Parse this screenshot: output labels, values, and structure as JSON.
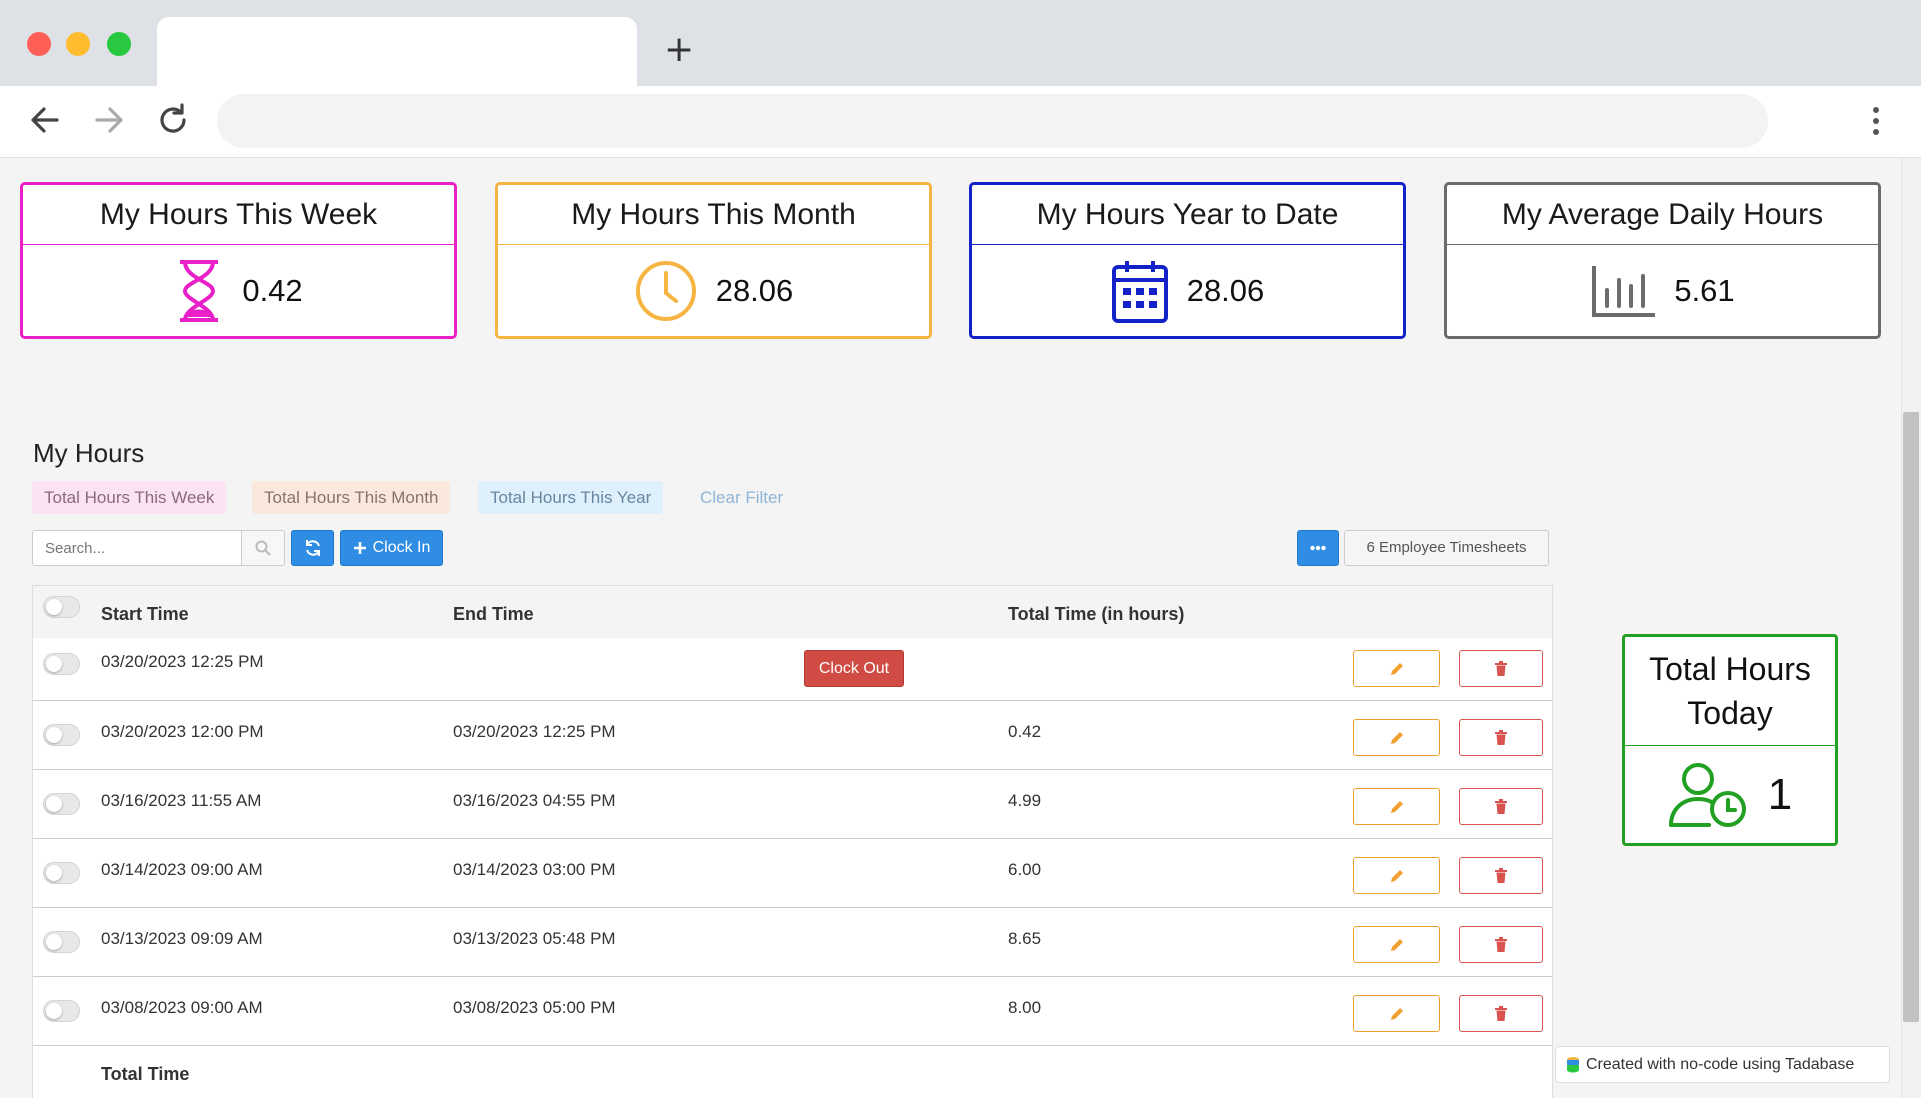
{
  "browser": {
    "new_tab": "+"
  },
  "cards": [
    {
      "title": "My Hours This Week",
      "value": "0.42",
      "color": "#e91fc7",
      "icon": "hourglass-icon"
    },
    {
      "title": "My Hours This Month",
      "value": "28.06",
      "color": "#f6b442",
      "icon": "clock-icon"
    },
    {
      "title": "My Hours Year to Date",
      "value": "28.06",
      "color": "#1322c8",
      "icon": "calendar-icon"
    },
    {
      "title": "My Average Daily Hours",
      "value": "5.61",
      "color": "#6b6b6b",
      "icon": "bar-chart-icon"
    }
  ],
  "section": {
    "title": "My Hours",
    "filters": {
      "week": "Total Hours This Week",
      "month": "Total Hours This Month",
      "year": "Total Hours This Year",
      "clear": "Clear Filter"
    },
    "search_placeholder": "Search...",
    "clock_in_label": "Clock In",
    "timesheets_label": "6 Employee Timesheets"
  },
  "table": {
    "headers": {
      "start": "Start Time",
      "end": "End Time",
      "total": "Total Time (in hours)"
    },
    "clock_out_label": "Clock Out",
    "rows": [
      {
        "start": "03/20/2023 12:25 PM",
        "end": "",
        "total": ""
      },
      {
        "start": "03/20/2023 12:00 PM",
        "end": "03/20/2023 12:25 PM",
        "total": "0.42"
      },
      {
        "start": "03/16/2023 11:55 AM",
        "end": "03/16/2023 04:55 PM",
        "total": "4.99"
      },
      {
        "start": "03/14/2023 09:00 AM",
        "end": "03/14/2023 03:00 PM",
        "total": "6.00"
      },
      {
        "start": "03/13/2023 09:09 AM",
        "end": "03/13/2023 05:48 PM",
        "total": "8.65"
      },
      {
        "start": "03/08/2023 09:00 AM",
        "end": "03/08/2023 05:00 PM",
        "total": "8.00"
      }
    ],
    "footer_label": "Total Time"
  },
  "today": {
    "title_line1": "Total Hours",
    "title_line2": "Today",
    "value": "1",
    "color": "#22a022"
  },
  "tadabase_badge": "Created with no-code using Tadabase"
}
